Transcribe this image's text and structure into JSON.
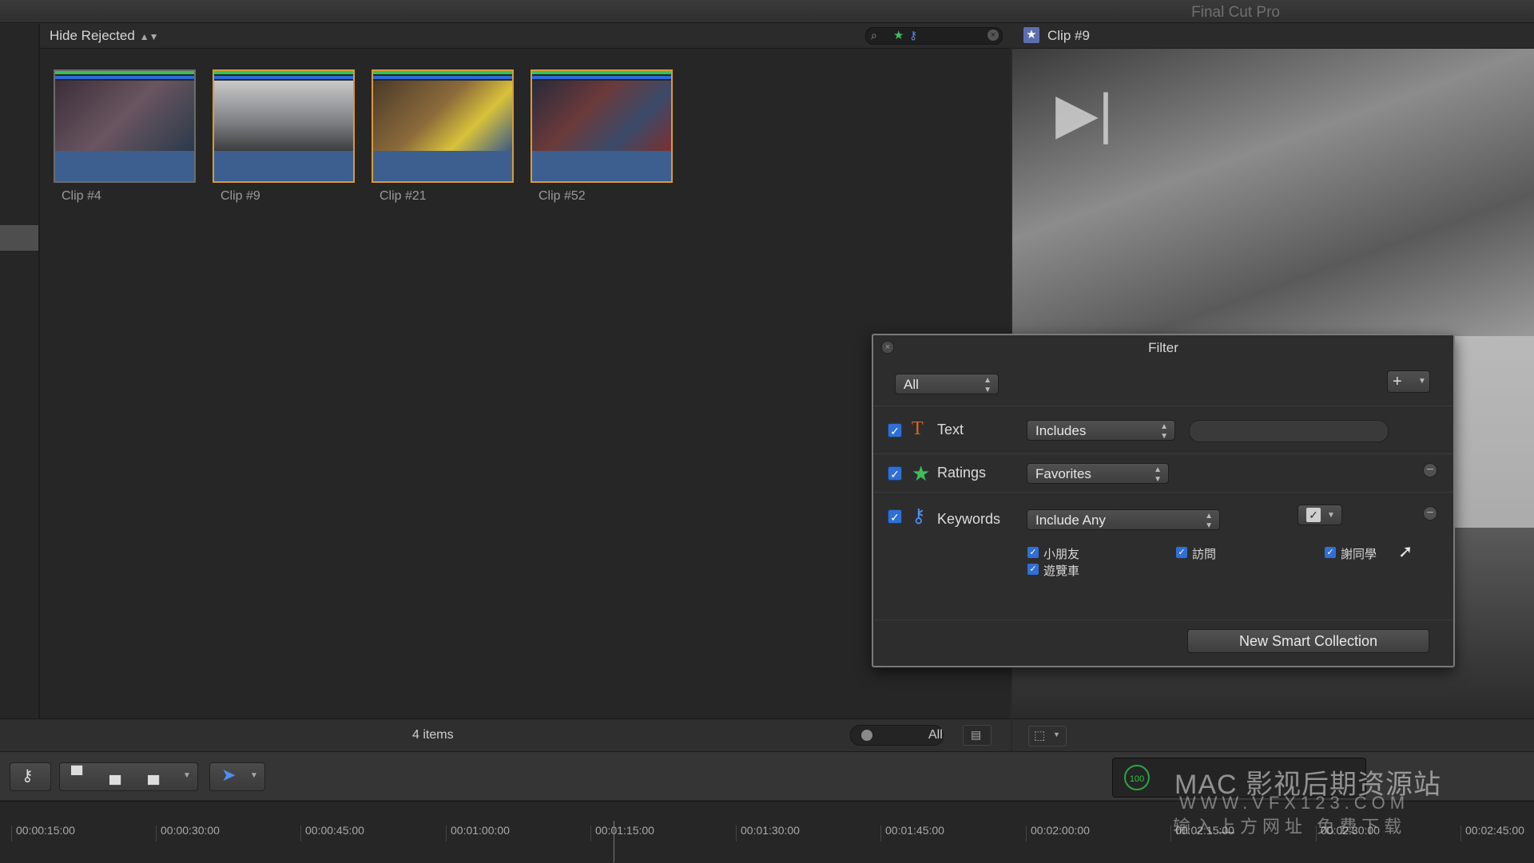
{
  "app": {
    "title": "Final Cut Pro"
  },
  "browser": {
    "filter_menu": "Hide Rejected",
    "clips": [
      {
        "label": "Clip #4",
        "color": "#6a5560"
      },
      {
        "label": "Clip #9",
        "color": "#7d7f83"
      },
      {
        "label": "Clip #21",
        "color": "#8c6b3a"
      },
      {
        "label": "Clip #52",
        "color": "#6b3a3a"
      }
    ],
    "footer": {
      "count": "4 items",
      "duration_filter": "All"
    }
  },
  "viewer": {
    "title": "Clip #9"
  },
  "toolbar": {
    "timecode_badge": "100"
  },
  "timeline": {
    "ticks": [
      "00:00:15:00",
      "00:00:30:00",
      "00:00:45:00",
      "00:01:00:00",
      "00:01:15:00",
      "00:01:30:00",
      "00:01:45:00",
      "00:02:00:00",
      "00:02:15:00",
      "00:02:30:00",
      "00:02:45:00"
    ]
  },
  "watermark": {
    "line1": "MAC 影视后期资源站",
    "line2": "WWW.VFX123.COM",
    "line3": "输入上方网址 免费下载"
  },
  "filter_dialog": {
    "title": "Filter",
    "match": "All",
    "rows": {
      "text": {
        "label": "Text",
        "mode": "Includes",
        "icon": "text-T-icon"
      },
      "ratings": {
        "label": "Ratings",
        "mode": "Favorites",
        "icon": "star-icon"
      },
      "keywords": {
        "label": "Keywords",
        "mode": "Include Any",
        "icon": "key-icon",
        "items": [
          "小朋友",
          "訪問",
          "謝同學",
          "遊覽車"
        ]
      }
    },
    "new_smart_collection": "New Smart Collection"
  },
  "colors": {
    "accent_blue": "#2f6fd6",
    "selection_orange": "#d79b3a",
    "favorite_green": "#31c35a",
    "keyword_blue": "#2f6ad8"
  }
}
